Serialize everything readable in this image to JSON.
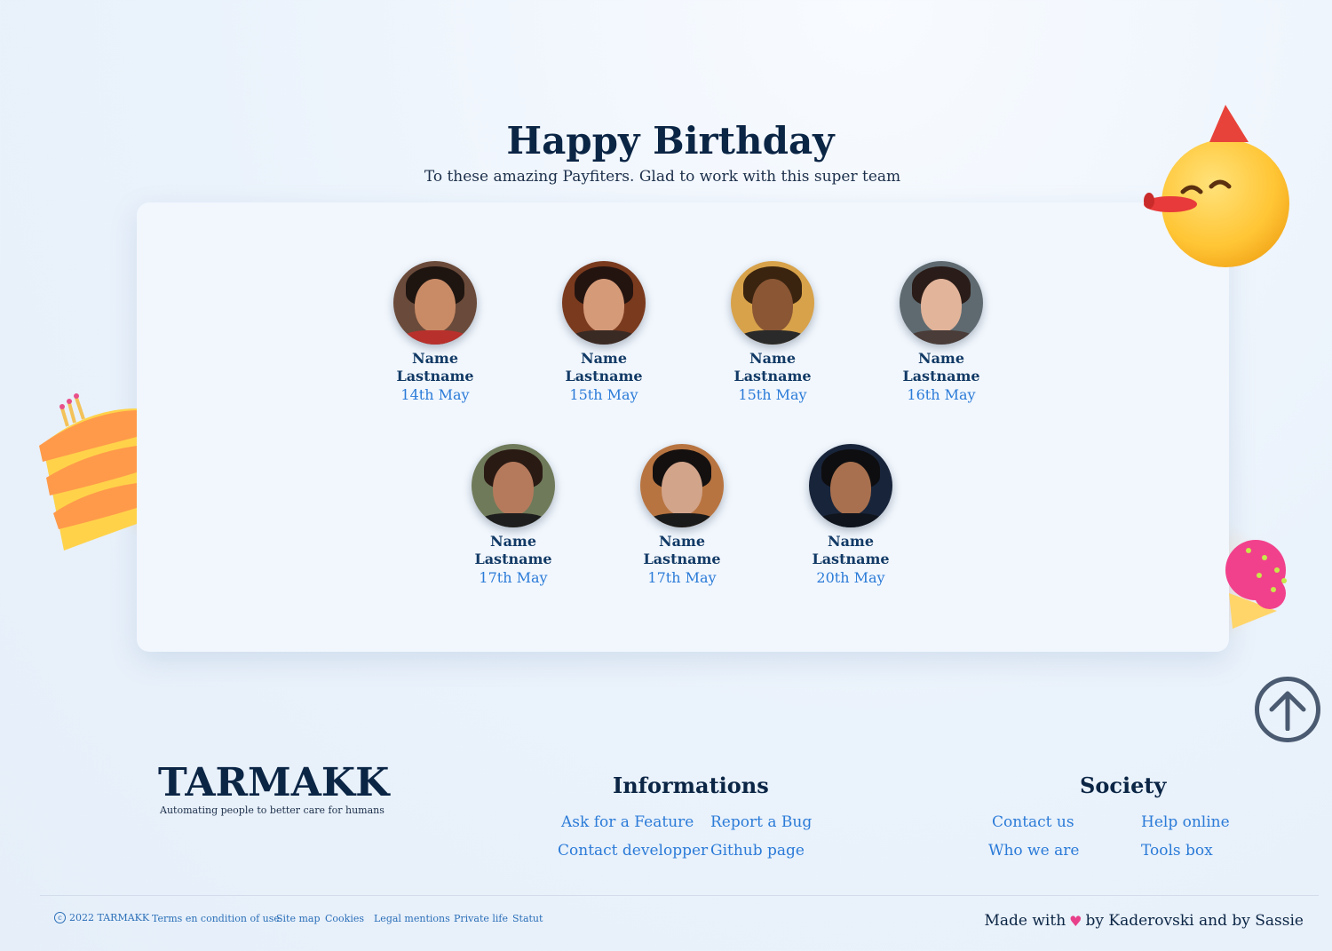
{
  "hero": {
    "title": "Happy Birthday",
    "subtitle": "To these amazing Payfiters. Glad to work with this super team"
  },
  "people": [
    {
      "first": "Name",
      "last": "Lastname",
      "date": "14th May"
    },
    {
      "first": "Name",
      "last": "Lastname",
      "date": "15th May"
    },
    {
      "first": "Name",
      "last": "Lastname",
      "date": "15th May"
    },
    {
      "first": "Name",
      "last": "Lastname",
      "date": "16th May"
    },
    {
      "first": "Name",
      "last": "Lastname",
      "date": "17th May"
    },
    {
      "first": "Name",
      "last": "Lastname",
      "date": "17th May"
    },
    {
      "first": "Name",
      "last": "Lastname",
      "date": "20th May"
    }
  ],
  "footer": {
    "brand_name": "TARMAKK",
    "brand_tagline": "Automating people to better care for humans",
    "informations": {
      "heading": "Informations",
      "links": [
        "Ask for a Feature",
        "Report a Bug",
        "Contact developper",
        "Github page"
      ]
    },
    "society": {
      "heading": "Society",
      "links": [
        "Contact us",
        "Help online",
        "Who we are",
        "Tools box"
      ]
    },
    "copyright": "2022 TARMAKK",
    "legal_links": [
      "Terms en condition of use",
      "Site map",
      "Cookies",
      "Legal mentions",
      "Private life",
      "Statut"
    ],
    "made_with_prefix": "Made with",
    "made_with_suffix": "by Kaderovski and by Sassie"
  },
  "colors": {
    "navy": "#0b2545",
    "link_blue": "#2b7bd8",
    "card_bg": "#f2f7fd"
  },
  "icons": [
    "scroll-to-top-arrow-icon",
    "heart-icon",
    "copyright-icon",
    "party-emoji",
    "birthday-cake",
    "ice-cream"
  ]
}
